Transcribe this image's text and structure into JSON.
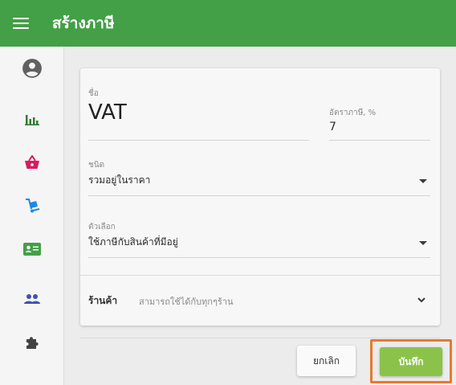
{
  "header": {
    "title": "สร้างภาษี",
    "menu_icon": "menu-icon",
    "color": "#43a047"
  },
  "sidebar": {
    "items": [
      {
        "icon": "account-circle-icon",
        "color": "#616161"
      },
      {
        "icon": "bar-chart-icon",
        "color": "#2e7d32"
      },
      {
        "icon": "shopping-basket-icon",
        "color": "#d81b60"
      },
      {
        "icon": "hand-truck-icon",
        "color": "#1e88e5"
      },
      {
        "icon": "id-card-icon",
        "color": "#43a047"
      },
      {
        "icon": "people-icon",
        "color": "#3f51b5"
      },
      {
        "icon": "puzzle-piece-icon",
        "color": "#424242"
      }
    ]
  },
  "form": {
    "name": {
      "label": "ชื่อ",
      "value": "VAT"
    },
    "rate": {
      "label": "อัตราภาษี, %",
      "value": "7"
    },
    "type": {
      "label": "ชนิด",
      "value": "รวมอยู่ในราคา"
    },
    "option": {
      "label": "ตัวเลือก",
      "value": "ใช้ภาษีกับสินค้าที่มีอยู่"
    },
    "store": {
      "label": "ร้านค้า",
      "value": "สามารถใช้ได้กับทุกๆร้าน"
    }
  },
  "actions": {
    "cancel": "ยกเลิก",
    "save": "บันทึก",
    "save_color": "#8bc34a",
    "highlight_color": "#e8792b"
  }
}
